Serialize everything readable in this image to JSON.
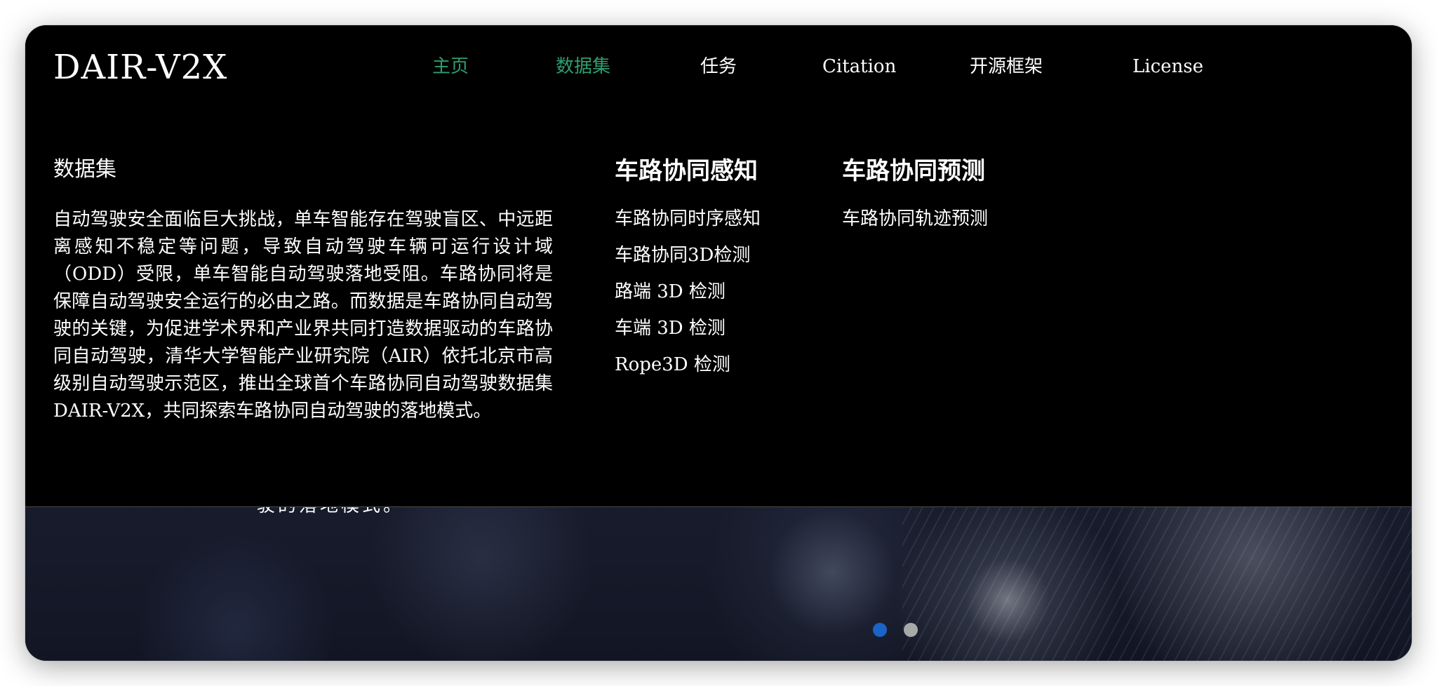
{
  "logo": "DAIR-V2X",
  "nav": {
    "items": [
      {
        "label": "主页"
      },
      {
        "label": "数据集"
      },
      {
        "label": "任务"
      },
      {
        "label": "Citation"
      },
      {
        "label": "开源框架"
      },
      {
        "label": "License"
      }
    ],
    "active_color": "#2f9e6e"
  },
  "dropdown": {
    "title": "数据集",
    "description": "自动驾驶安全面临巨大挑战，单车智能存在驾驶盲区、中远距离感知不稳定等问题，导致自动驾驶车辆可运行设计域（ODD）受限，单车智能自动驾驶落地受阻。车路协同将是保障自动驾驶安全运行的必由之路。而数据是车路协同自动驾驶的关键，为促进学术界和产业界共同打造数据驱动的车路协同自动驾驶，清华大学智能产业研究院（AIR）依托北京市高级别自动驾驶示范区，推出全球首个车路协同自动驾驶数据集DAIR-V2X，共同探索车路协同自动驾驶的落地模式。",
    "perception": {
      "title": "车路协同感知",
      "items": [
        "车路协同时序感知",
        "车路协同3D检测",
        "路端 3D 检测",
        "车端 3D 检测",
        "Rope3D 检测"
      ]
    },
    "prediction": {
      "title": "车路协同预测",
      "items": [
        "车路协同轨迹预测"
      ]
    }
  },
  "hero": {
    "text": "驶的落地模式。"
  },
  "carousel": {
    "active_color": "#1a63c8",
    "inactive_color": "#a8a8a8",
    "dots": [
      {
        "label": "slide-1"
      },
      {
        "label": "slide-2"
      }
    ]
  }
}
